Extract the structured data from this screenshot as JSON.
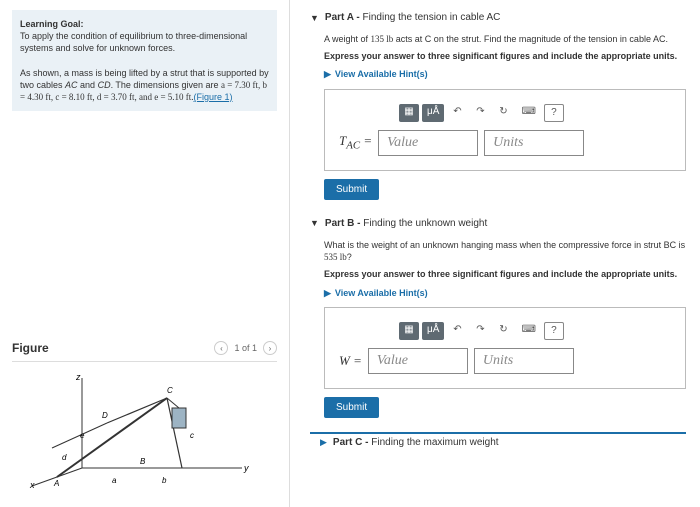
{
  "goal": {
    "heading": "Learning Goal:",
    "line1": "To apply the condition of equilibrium to three-dimensional systems and solve for unknown forces.",
    "line2a": "As shown, a mass is being lifted by a strut that is supported by two cables ",
    "line2_ac": "AC",
    "line2b": " and ",
    "line2_cd": "CD",
    "line2c": ". The dimensions given are ",
    "dims": "a = 7.30 ft, b = 4.30 ft, c = 8.10 ft, d = 3.70 ft, and e = 5.10 ft.",
    "fig_link": "(Figure 1)"
  },
  "figure": {
    "title": "Figure",
    "pager": "1 of 1"
  },
  "partA": {
    "head_label": "Part A - ",
    "head_text": "Finding the tension in cable AC",
    "line1a": "A weight of ",
    "weight": "135 lb",
    "line1b": " acts at C on the strut. Find the magnitude of the tension in cable AC.",
    "instruct": "Express your answer to three significant figures and include the appropriate units.",
    "hints": "View Available Hint(s)",
    "var": "T_{AC} =",
    "value_ph": "Value",
    "units_ph": "Units",
    "submit": "Submit"
  },
  "partB": {
    "head_label": "Part B - ",
    "head_text": "Finding the unknown weight",
    "line1a": "What is the weight of an unknown hanging mass when the compressive force in strut BC is ",
    "force": "535 lb",
    "line1b": "?",
    "instruct": "Express your answer to three significant figures and include the appropriate units.",
    "hints": "View Available Hint(s)",
    "var": "W =",
    "value_ph": "Value",
    "units_ph": "Units",
    "submit": "Submit"
  },
  "partC": {
    "head_label": "Part C - ",
    "head_text": "Finding the maximum weight"
  },
  "toolbar": {
    "mua": "μÅ",
    "keyboard": "⌨",
    "help": "?"
  }
}
